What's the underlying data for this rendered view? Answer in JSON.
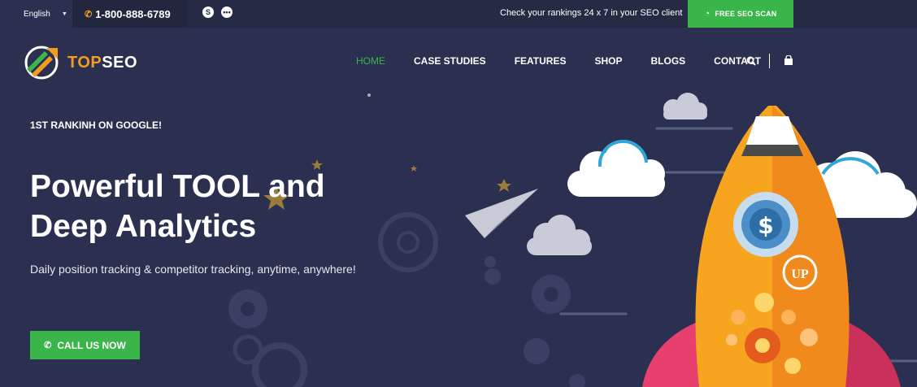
{
  "topbar": {
    "language": "English",
    "phone": "1-800-888-6789",
    "tagline": "Check your rankings 24 x 7 in your SEO client",
    "scan_button": "FREE SEO SCAN"
  },
  "logo": {
    "part1": "TOP",
    "part2": "SEO"
  },
  "nav": {
    "items": [
      "HOME",
      "CASE STUDIES",
      "FEATURES",
      "SHOP",
      "BLOGS",
      "CONTACT"
    ]
  },
  "hero": {
    "eyebrow": "1ST RANKINH ON GOOGLE!",
    "headline_line1": "Powerful TOOL and",
    "headline_line2": "Deep Analytics",
    "subtitle": "Daily position tracking & competitor tracking, anytime, anywhere!",
    "cta": "CALL US NOW",
    "rocket_badge": "UP"
  },
  "colors": {
    "background": "#2b3050",
    "accent_green": "#3ab54a",
    "accent_orange": "#f39c22"
  }
}
